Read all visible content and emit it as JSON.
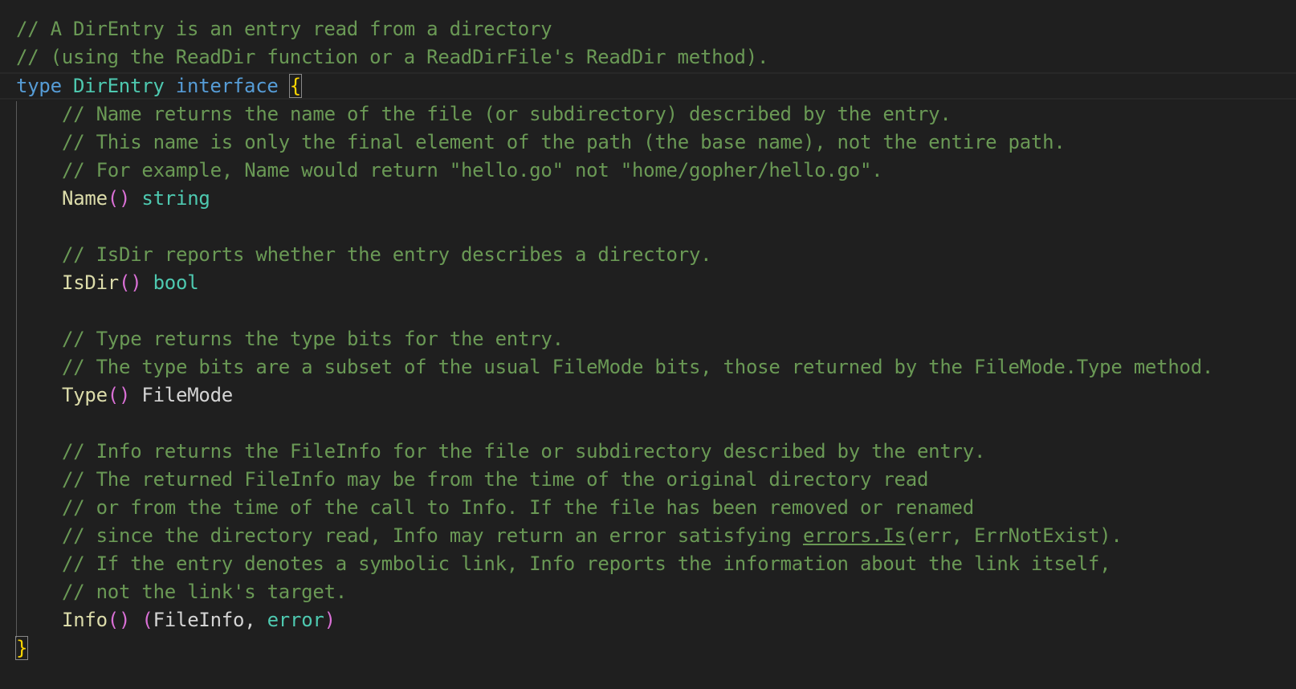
{
  "editor": {
    "line1": "// A DirEntry is an entry read from a directory",
    "line2": "// (using the ReadDir function or a ReadDirFile's ReadDir method).",
    "line3": {
      "kw_type": "type",
      "type_name": "DirEntry",
      "kw_interface": "interface",
      "open_brace": "{"
    },
    "line4": "// Name returns the name of the file (or subdirectory) described by the entry.",
    "line5": "// This name is only the final element of the path (the base name), not the entire path.",
    "line6": "// For example, Name would return \"hello.go\" not \"home/gopher/hello.go\".",
    "line7": {
      "fn": "Name",
      "parens": "()",
      "ret": "string"
    },
    "line9": "// IsDir reports whether the entry describes a directory.",
    "line10": {
      "fn": "IsDir",
      "parens": "()",
      "ret": "bool"
    },
    "line12": "// Type returns the type bits for the entry.",
    "line13": "// The type bits are a subset of the usual FileMode bits, those returned by the FileMode.Type method.",
    "line14": {
      "fn": "Type",
      "parens": "()",
      "ret": "FileMode"
    },
    "line16": "// Info returns the FileInfo for the file or subdirectory described by the entry.",
    "line17": "// The returned FileInfo may be from the time of the original directory read",
    "line18": "// or from the time of the call to Info. If the file has been removed or renamed",
    "line19": {
      "pre": "// since the directory read, Info may return an error satisfying ",
      "link": "errors.Is",
      "post": "(err, ErrNotExist)."
    },
    "line20": "// If the entry denotes a symbolic link, Info reports the information about the link itself,",
    "line21": "// not the link's target.",
    "line22": {
      "fn": "Info",
      "parens": "()",
      "open_paren": "(",
      "ret1": "FileInfo",
      "comma": ", ",
      "ret2": "error",
      "close_paren": ")"
    },
    "line23": {
      "close_brace": "}"
    }
  },
  "colors": {
    "background": "#1f1f1f",
    "comment": "#6a9955",
    "keyword": "#569cd6",
    "type": "#4ec9b0",
    "function": "#dcdcaa",
    "bracket_level1": "#ffd700",
    "bracket_level2": "#da70d6"
  }
}
